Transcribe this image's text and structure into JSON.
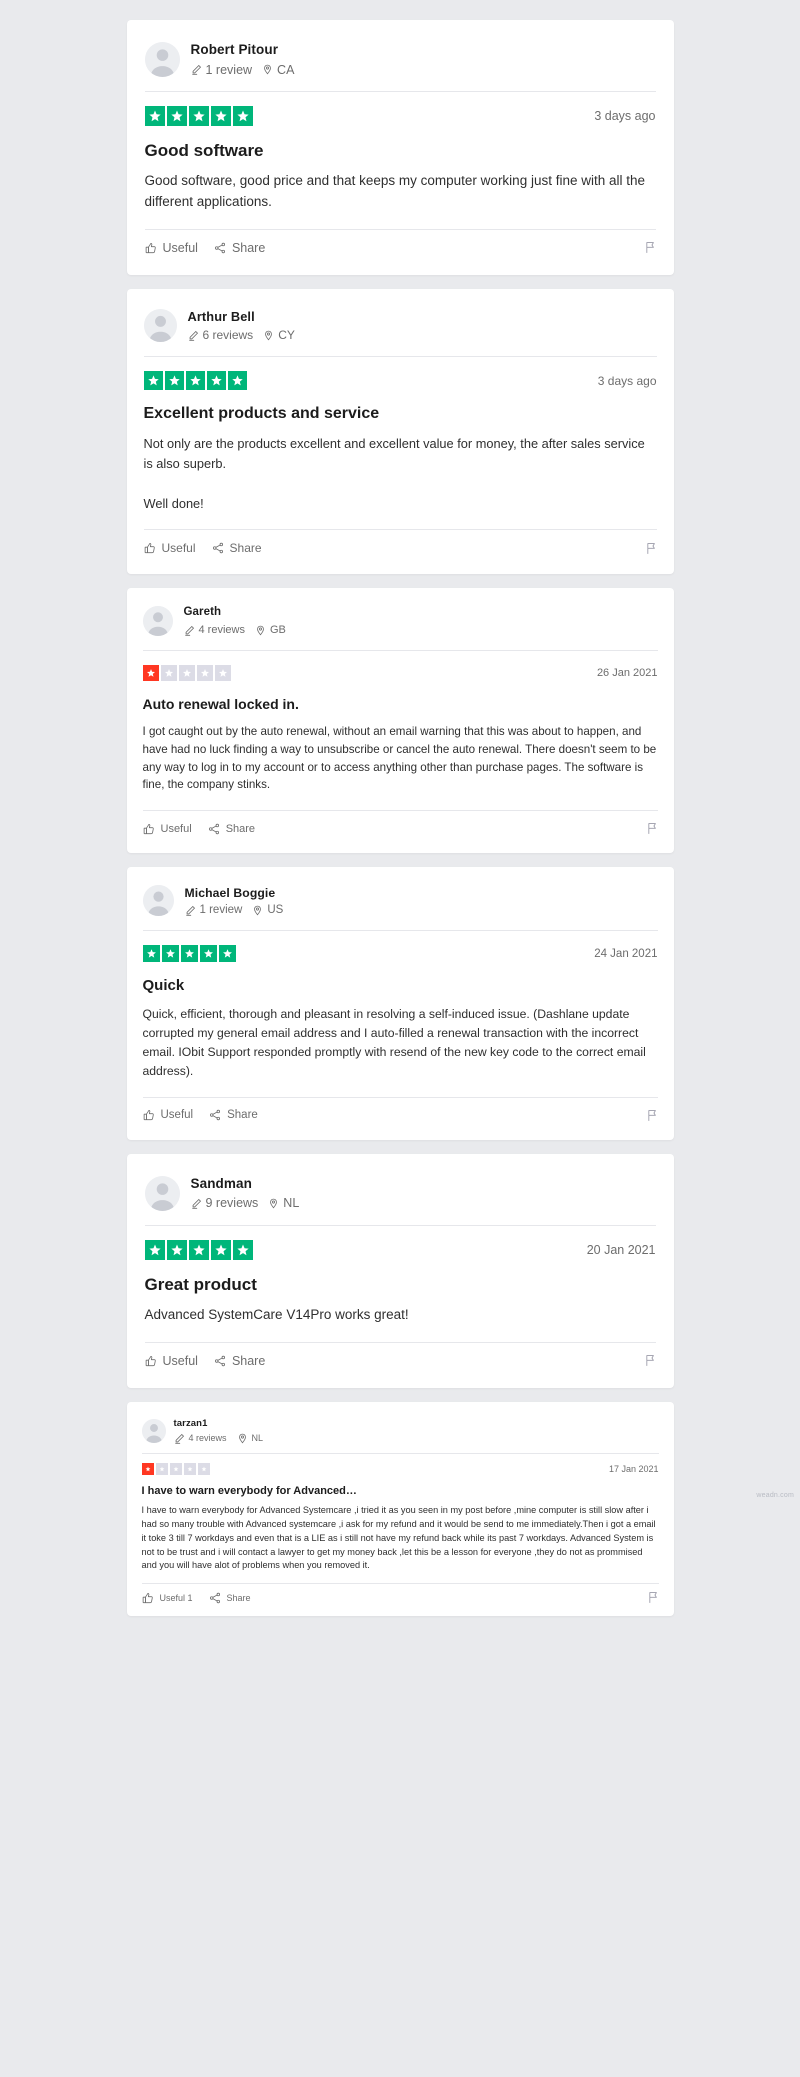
{
  "ui": {
    "useful_label": "Useful",
    "share_label": "Share",
    "report_icon": "flag-icon",
    "thumbs_up_icon": "thumbs-up-icon",
    "share_icon": "share-icon",
    "pencil_icon": "pencil-icon",
    "location_icon": "location-pin-icon",
    "avatar_icon": "avatar-placeholder-icon"
  },
  "colors": {
    "star_green": "#00b67a",
    "star_red": "#ff3722",
    "star_empty": "#dcdce6",
    "page_background": "#e9eaed",
    "card_background": "#ffffff"
  },
  "watermark": "weadn.com",
  "reviews": [
    {
      "name": "Robert Pitour",
      "reviews_count": "1 review",
      "location": "CA",
      "rating": 5,
      "date": "3 days ago",
      "title": "Good software",
      "body": "Good software, good price and that keeps my computer working just fine with all the different applications.",
      "useful_label": "Useful",
      "share_label": "Share"
    },
    {
      "name": "Arthur Bell",
      "reviews_count": "6 reviews",
      "location": "CY",
      "rating": 5,
      "date": "3 days ago",
      "title": "Excellent products and service",
      "body": "Not only are the products excellent and excellent value for money, the after sales service is also superb.\n\nWell done!",
      "useful_label": "Useful",
      "share_label": "Share"
    },
    {
      "name": "Gareth",
      "reviews_count": "4 reviews",
      "location": "GB",
      "rating": 1,
      "date": "26 Jan 2021",
      "title": "Auto renewal locked in.",
      "body": "I got caught out by the auto renewal, without an email warning that this was about to happen, and have had no luck finding a way to unsubscribe or cancel the auto renewal. There doesn't seem to be any way to log in to my account or to access anything other than purchase pages. The software is fine, the company stinks.",
      "useful_label": "Useful",
      "share_label": "Share"
    },
    {
      "name": "Michael Boggie",
      "reviews_count": "1 review",
      "location": "US",
      "rating": 5,
      "date": "24 Jan 2021",
      "title": "Quick",
      "body": "Quick, efficient, thorough and pleasant in resolving a self-induced issue. (Dashlane update corrupted my general email address and I auto-filled a renewal transaction with the incorrect email. IObit Support responded promptly with resend of the new key code to the correct email address).",
      "useful_label": "Useful",
      "share_label": "Share"
    },
    {
      "name": "Sandman",
      "reviews_count": "9 reviews",
      "location": "NL",
      "rating": 5,
      "date": "20 Jan 2021",
      "title": "Great product",
      "body": "Advanced SystemCare V14Pro works great!",
      "useful_label": "Useful",
      "share_label": "Share"
    },
    {
      "name": "tarzan1",
      "reviews_count": "4 reviews",
      "location": "NL",
      "rating": 1,
      "date": "17 Jan 2021",
      "title": "I have to warn everybody for Advanced…",
      "body": "I have to warn everybody for Advanced Systemcare ,i tried it as you seen in my post before ,mine computer is still slow after i had so many trouble with Advanced systemcare ,i ask for my refund and it would be send to me immediately.Then i got a email it toke 3 till 7 workdays and even that is a LIE as i still not have my refund back while its past 7 workdays. Advanced System is not to be trust and i will contact a lawyer to get my money back ,let this be a lesson for everyone ,they do not as prommised and you will have alot of problems when you removed it.",
      "useful_label": "Useful 1",
      "share_label": "Share"
    }
  ]
}
